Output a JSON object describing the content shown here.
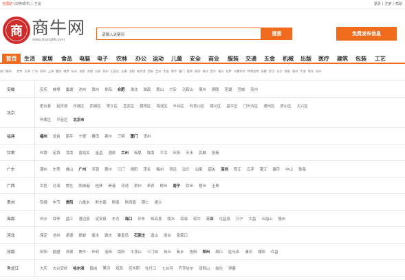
{
  "topbar": {
    "location_label": "全国站",
    "switch_city": "[切换城市]",
    "separator": "|",
    "main_site": "主站",
    "login": "登录",
    "register": "注册",
    "help": "帮助"
  },
  "brand": {
    "logo_char": "商",
    "name": "商牛网",
    "url": "www.shang66.com"
  },
  "search": {
    "placeholder": "请输入关键词",
    "button": "搜索"
  },
  "post_button": "免费发布信息",
  "nav": [
    {
      "label": "首页",
      "active": true
    },
    {
      "label": "生活"
    },
    {
      "label": "家居"
    },
    {
      "label": "食品"
    },
    {
      "label": "电脑"
    },
    {
      "label": "电子"
    },
    {
      "label": "农林"
    },
    {
      "label": "办公"
    },
    {
      "label": "运动"
    },
    {
      "label": "儿童"
    },
    {
      "label": "安全"
    },
    {
      "label": "商业"
    },
    {
      "label": "服装"
    },
    {
      "label": "交通"
    },
    {
      "label": "五金"
    },
    {
      "label": "机械"
    },
    {
      "label": "出版"
    },
    {
      "label": "医疗"
    },
    {
      "label": "建筑"
    },
    {
      "label": "包装"
    },
    {
      "label": "工艺"
    }
  ],
  "subnav": [
    "热门城市：",
    "北京",
    "天津",
    "广州",
    "深圳",
    "上海",
    "重庆",
    "南京",
    "杭州",
    "合肥",
    "济南",
    "太原",
    "郑州",
    "石家庄",
    "长春",
    "沈阳",
    "哈尔滨",
    "西安",
    "兰州",
    "大连",
    "南宁",
    "厦门",
    "昆明",
    "贵阳",
    "海口",
    "西宁",
    "银川",
    "拉萨",
    "乌鲁木齐",
    "呼和浩特",
    "成都",
    "武汉",
    "长沙",
    "南昌",
    "福州",
    "宁波",
    "青岛",
    "苏州"
  ],
  "provinces": [
    {
      "name": "安徽",
      "lines": [
        [
          "安庆",
          "蚌埠",
          "巢湖",
          "池州",
          "滁州",
          "阜阳",
          "合肥",
          "淮北",
          "淮南",
          "黄山",
          "六安",
          "马鞍山",
          "宿州",
          "铜陵",
          "芜湖",
          "宣城",
          "亳州"
        ]
      ]
    },
    {
      "name": "北京",
      "lines": [
        [
          "密云县",
          "延庆县",
          "东城区",
          "西城区",
          "崇文区",
          "宣武区",
          "朝阳区",
          "海淀区",
          "丰台区",
          "石景山区",
          "顺义区",
          "昌平区",
          "门头沟区",
          "通州区",
          "房山区",
          "大兴区"
        ],
        [
          "怀柔区",
          "平谷区",
          "北京市"
        ]
      ]
    },
    {
      "name": "福建",
      "lines": [
        [
          "福州",
          "龙岩",
          "南平",
          "宁德",
          "莆田",
          "泉州",
          "三明",
          "厦门",
          "漳州"
        ]
      ]
    },
    {
      "name": "甘肃",
      "lines": [
        [
          "白银",
          "定西",
          "甘南",
          "嘉峪关",
          "金昌",
          "酒泉",
          "兰州",
          "临夏",
          "陇南",
          "平凉",
          "庆阳",
          "天水",
          "武威",
          "张掖"
        ]
      ]
    },
    {
      "name": "广东",
      "lines": [
        [
          "潮州",
          "东莞",
          "佛山",
          "广州",
          "河源",
          "惠州",
          "江门",
          "揭阳",
          "茂名",
          "梅州",
          "清远",
          "汕头",
          "汕尾",
          "韶关",
          "深圳",
          "阳江",
          "云浮",
          "湛江",
          "肇庆",
          "中山",
          "珠海"
        ]
      ]
    },
    {
      "name": "广西",
      "lines": [
        [
          "百色",
          "北海",
          "崇左",
          "防城港",
          "桂林",
          "贵港",
          "河池",
          "贺州",
          "来宾",
          "柳州",
          "南宁",
          "钦州",
          "梧州",
          "玉林"
        ]
      ]
    },
    {
      "name": "贵州",
      "lines": [
        [
          "安顺",
          "毕节",
          "贵阳",
          "六盘水",
          "黔东南",
          "黔南",
          "黔西南",
          "铜仁",
          "遵义"
        ]
      ]
    },
    {
      "name": "海南",
      "lines": [
        [
          "白沙",
          "保亭",
          "昌江",
          "澄迈县",
          "定安县",
          "东方",
          "海口",
          "乐东",
          "临高县",
          "陵水",
          "琼海",
          "琼中",
          "三亚",
          "屯昌县",
          "万宁",
          "文昌",
          "五指山",
          "儋州"
        ]
      ]
    },
    {
      "name": "河北",
      "lines": [
        [
          "保定",
          "沧州",
          "承德",
          "邯郸",
          "衡水",
          "廊坊",
          "秦皇岛",
          "石家庄",
          "唐山",
          "邢台",
          "张家口"
        ]
      ]
    },
    {
      "name": "河南",
      "lines": [
        [
          "安阳",
          "鹤壁",
          "济源",
          "焦作",
          "开封",
          "洛阳",
          "南阳",
          "平顶山",
          "三门峡",
          "商丘",
          "新乡",
          "信阳",
          "郑州",
          "周口",
          "驻马店",
          "漯河",
          "濮阳",
          "许昌"
        ]
      ]
    },
    {
      "name": "黑龙江",
      "lines": [
        [
          "大庆",
          "大兴安岭",
          "哈尔滨",
          "鹤岗",
          "黑河",
          "鸡西",
          "佳木斯",
          "牡丹江",
          "七台河",
          "齐齐哈尔",
          "双鸭山",
          "绥化",
          "伊春"
        ]
      ]
    }
  ]
}
